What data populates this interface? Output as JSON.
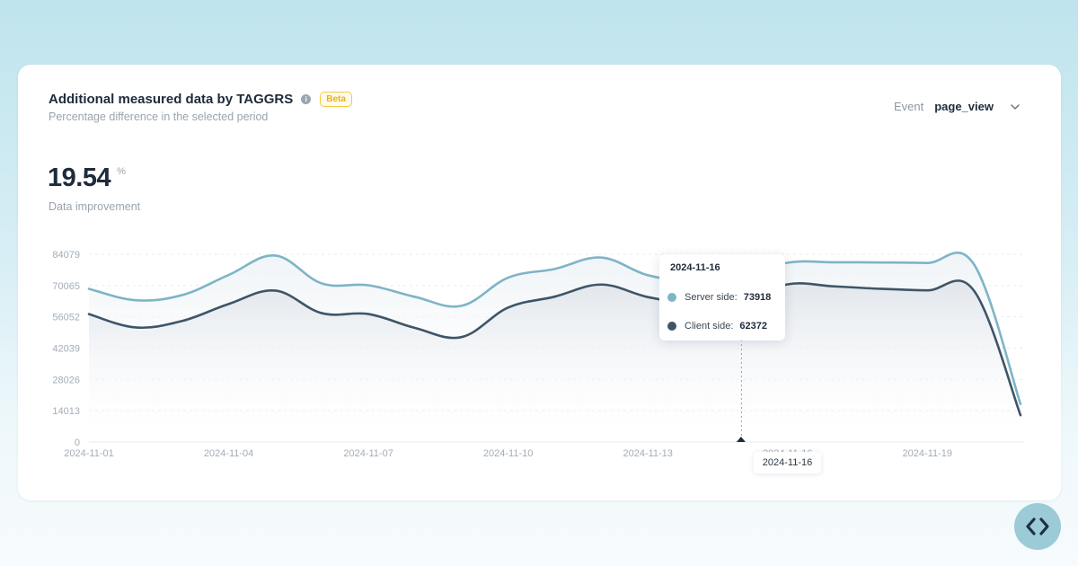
{
  "header": {
    "title": "Additional measured data by TAGGRS",
    "info_icon": "info-icon",
    "badge": "Beta",
    "subtitle": "Percentage difference in the selected period"
  },
  "event_selector": {
    "label": "Event",
    "value": "page_view",
    "icon": "chevron-down-icon"
  },
  "kpi": {
    "value": "19.54",
    "unit": "%",
    "caption": "Data improvement"
  },
  "tooltip": {
    "date": "2024-11-16",
    "rows": [
      {
        "label": "Server side:",
        "value": "73918",
        "color": "#7eb4c7"
      },
      {
        "label": "Client side:",
        "value": "62372",
        "color": "#3f5566"
      }
    ]
  },
  "hover_x_label": "2024-11-16",
  "nav_button_icon": "code-chevrons-icon",
  "colors": {
    "server": "#7eb4c7",
    "client": "#3f5566",
    "accent_badge": "#f3c949"
  },
  "chart_data": {
    "type": "area",
    "x": [
      "2024-11-01",
      "2024-11-02",
      "2024-11-03",
      "2024-11-04",
      "2024-11-05",
      "2024-11-06",
      "2024-11-07",
      "2024-11-08",
      "2024-11-09",
      "2024-11-10",
      "2024-11-11",
      "2024-11-12",
      "2024-11-13",
      "2024-11-14",
      "2024-11-15",
      "2024-11-16",
      "2024-11-17",
      "2024-11-18",
      "2024-11-19",
      "2024-11-20",
      "2024-11-21"
    ],
    "x_ticks": [
      "2024-11-01",
      "2024-11-04",
      "2024-11-07",
      "2024-11-10",
      "2024-11-13",
      "2024-11-16",
      "2024-11-19"
    ],
    "y_ticks": [
      0,
      14013,
      28026,
      42039,
      56052,
      70065,
      84079
    ],
    "ylim": [
      0,
      84079
    ],
    "series": [
      {
        "name": "Server side",
        "color": "#7eb4c7",
        "values": [
          68600,
          63500,
          65800,
          74800,
          83500,
          71000,
          70200,
          65000,
          61000,
          73600,
          77500,
          82600,
          74700,
          72000,
          73918,
          80300,
          80500,
          80400,
          80200,
          79600,
          17000
        ]
      },
      {
        "name": "Client side",
        "color": "#3f5566",
        "values": [
          57300,
          51300,
          54200,
          61800,
          67800,
          57700,
          57300,
          51100,
          47000,
          60200,
          65100,
          70500,
          64900,
          62000,
          62372,
          70600,
          69700,
          68600,
          67900,
          67800,
          12000
        ]
      }
    ],
    "hover_index": 14,
    "grid": true
  }
}
